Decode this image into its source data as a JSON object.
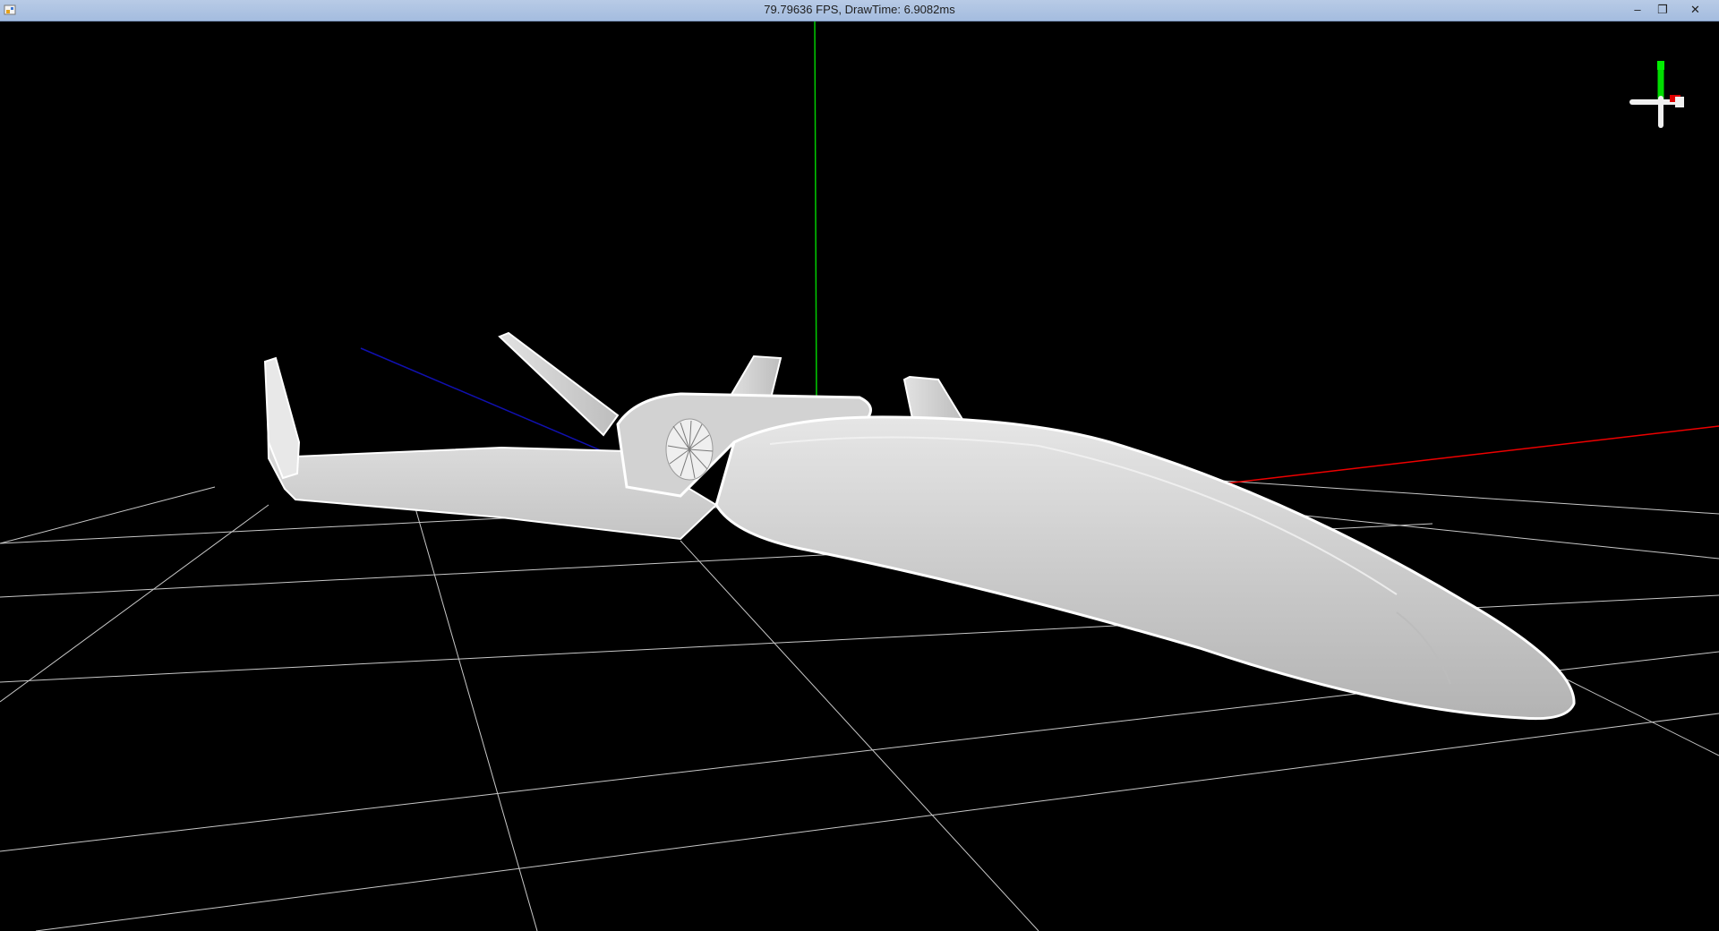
{
  "window": {
    "title": "79.79636 FPS, DrawTime: 6.9082ms",
    "minimize_glyph": "–",
    "restore_glyph": "❐",
    "close_glyph": "✕"
  },
  "viewport": {
    "background_color": "#000000",
    "grid_color": "#c8c8c8",
    "axis_colors": {
      "x": "#ff0000",
      "y": "#00cc00",
      "z": "#0000cc"
    },
    "model": "aircraft"
  },
  "gizmo": {
    "icon": "axis-gizmo-icon"
  }
}
